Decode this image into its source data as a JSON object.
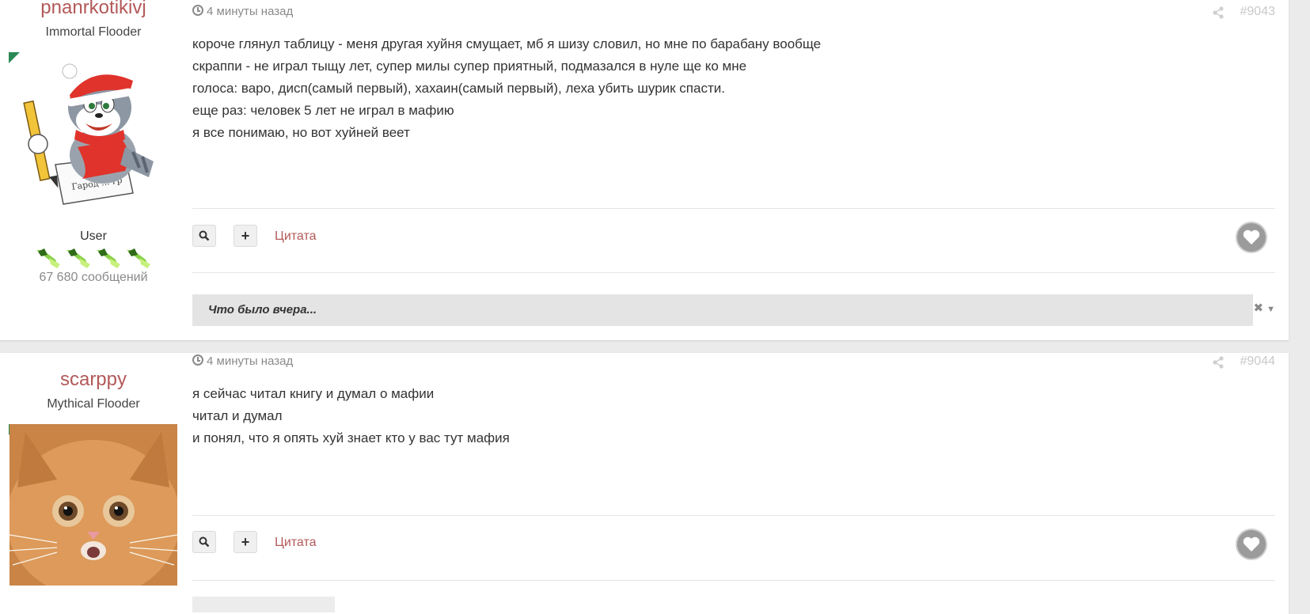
{
  "posts": [
    {
      "author": {
        "name": "pnanrkotikivj",
        "rank": "Immortal Flooder",
        "group": "User",
        "posts_count": "67 680 сообщений"
      },
      "time": "4 минуты назад",
      "number": "#9043",
      "lines": [
        "короче глянул таблицу - меня другая хуйня смущает, мб я шизу словил, но мне по барабану вообще",
        "скраппи - не играл тыщу лет, супер милы супер приятный, подмазался в нуле ще ко мне",
        "голоса: варо, дисп(самый первый), хахаин(самый первый), леха убить шурик спасти.",
        "",
        "еще раз: человек 5 лет не играл в мафию",
        "",
        "я все понимаю, но вот хуйней веет"
      ],
      "quote_label": "Цитата",
      "signature_label": "Что было вчера..."
    },
    {
      "author": {
        "name": "scarppy",
        "rank": "Mythical Flooder"
      },
      "time": "4 минуты назад",
      "number": "#9044",
      "lines": [
        "я сейчас читал книгу и думал о мафии",
        "читал и думал",
        "и понял, что я опять хуй знает кто у вас тут мафия"
      ],
      "quote_label": "Цитата"
    }
  ],
  "icons": {
    "clock": "clock-icon",
    "share": "share-icon",
    "search": "search-icon",
    "plus": "plus-icon",
    "heart": "heart-icon",
    "close": "close-icon",
    "caret": "caret-down-icon"
  },
  "colors": {
    "author_link": "#b35959",
    "online_flag": "#2a8a55",
    "post_number": "#c9c9c9"
  }
}
